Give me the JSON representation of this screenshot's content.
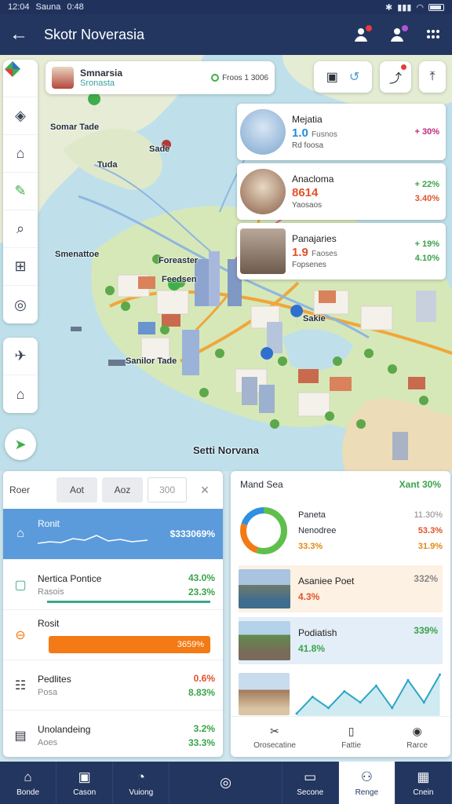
{
  "status": {
    "time": "12:04",
    "carrier": "Sauna",
    "extra": "0:48",
    "icons": [
      "bluetooth-icon",
      "signal-icon",
      "wifi-icon",
      "battery-icon"
    ]
  },
  "header": {
    "title": "Skotr Noverasia",
    "back_label": "←",
    "actions": [
      "user-alert-icon",
      "user-pin-icon",
      "more-icon"
    ]
  },
  "location_card": {
    "name": "Smnarsia",
    "subtitle": "Sronasta",
    "meta": "Froos 1 3006"
  },
  "map": {
    "labels": [
      "Somar Tade",
      "Sade",
      "Tuda",
      "Smenattoe",
      "Foreaster",
      "Feedsen",
      "Sanilor Tade",
      "Sakie",
      "Setti Norvana"
    ]
  },
  "poi_cards": [
    {
      "name": "Mejatia",
      "value": "1.0",
      "value_suffix": "Fusnos",
      "note": "Rd foosa",
      "pct": "+ 30%",
      "pct_color": "#c2277d"
    },
    {
      "name": "Anacloma",
      "value": "8614",
      "value_suffix": "",
      "note": "Yaosaos",
      "pct": "+ 22%",
      "pct2": "3.40%",
      "pct_color": "#3aa34a"
    },
    {
      "name": "Panajaries",
      "value": "1.9",
      "value_suffix": "Faoses",
      "note": "Fopsenes",
      "pct": "+ 19%",
      "pct2": "4.10%",
      "pct_color": "#3aa34a"
    }
  ],
  "left_panel": {
    "tabs": [
      "Roer",
      "Aot",
      "Aoz",
      "300"
    ],
    "close_label": "×",
    "rows": [
      {
        "name": "Ronit",
        "sub": "",
        "value": "$333069%",
        "value2": ""
      },
      {
        "name": "Nertica Pontice",
        "sub": "Rasois",
        "value": "43.0%",
        "value2": "23.3%"
      },
      {
        "name": "Rosit",
        "sub": "",
        "value": "3659%",
        "value2": ""
      },
      {
        "name": "Pedlites",
        "sub": "Posa",
        "value": "0.6%",
        "value2": "8.83%"
      },
      {
        "name": "Unolandeing",
        "sub": "Aoes",
        "value": "3.2%",
        "value2": "33.3%"
      }
    ]
  },
  "right_panel": {
    "title": "Mand Sea",
    "title_value": "Xant 30%",
    "donut": {
      "segments": [
        {
          "label": "Green",
          "value": 0.55,
          "color": "#5fbf4d"
        },
        {
          "label": "Orange",
          "value": 0.25,
          "color": "#f47a15"
        },
        {
          "label": "Blue",
          "value": 0.2,
          "color": "#2f8fe0"
        }
      ]
    },
    "donut_list": [
      {
        "name": "Paneta",
        "value": "11.30%",
        "color": "#666"
      },
      {
        "name": "Nenodree",
        "value": "53.3%",
        "color": "#e0532a"
      },
      {
        "name": "33.3%",
        "value": "31.9%",
        "color": "#e08a14"
      }
    ],
    "attractions": [
      {
        "name": "Asaniee Poet",
        "pct": "4.3%",
        "value": "332%",
        "bg": "#fdf1e3",
        "pct_color": "#e0532a",
        "value_color": "#888"
      },
      {
        "name": "Podiatish",
        "pct": "41.8%",
        "value": "339%",
        "bg": "#e3eef8",
        "pct_color": "#3aa34a",
        "value_color": "#3aa34a"
      }
    ],
    "chart_data": {
      "type": "line",
      "values": [
        2,
        5,
        3,
        6,
        4,
        7,
        3,
        8,
        4,
        9
      ]
    },
    "footer": [
      {
        "icon": "scissors-icon",
        "label": "Orosecatine"
      },
      {
        "icon": "document-icon",
        "label": "Fattie"
      },
      {
        "icon": "profile-icon",
        "label": "Rarce"
      }
    ]
  },
  "bottom_nav": [
    {
      "icon": "home-icon",
      "label": "Bonde"
    },
    {
      "icon": "box-icon",
      "label": "Cason"
    },
    {
      "icon": "compass-icon",
      "label": "Vuiong"
    },
    {
      "icon": "target-icon",
      "label": ""
    },
    {
      "icon": "window-icon",
      "label": "Secone"
    },
    {
      "icon": "person-icon",
      "label": "Renge"
    },
    {
      "icon": "image-icon",
      "label": "Cnein"
    }
  ]
}
